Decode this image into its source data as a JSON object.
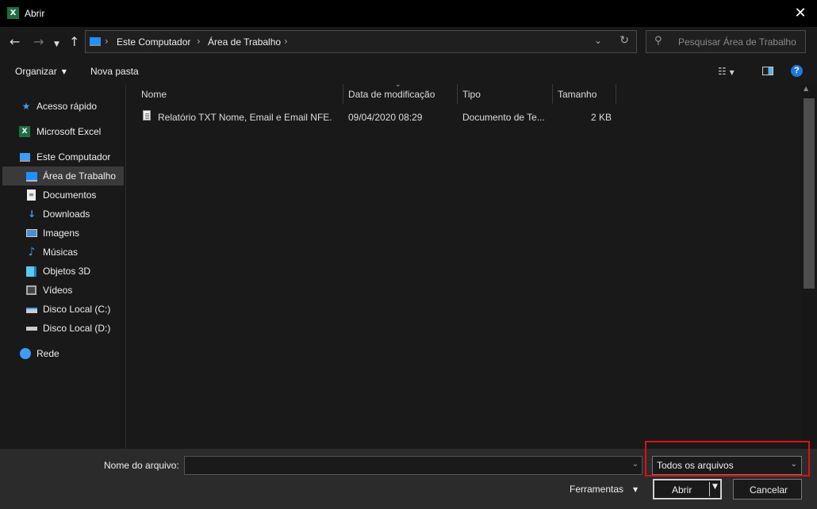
{
  "window": {
    "title": "Abrir",
    "app_icon": "excel-icon"
  },
  "address_bar": {
    "crumbs": [
      "Este Computador",
      "Área de Trabalho"
    ]
  },
  "search": {
    "placeholder": "Pesquisar Área de Trabalho"
  },
  "toolbar": {
    "organize_label": "Organizar",
    "new_folder_label": "Nova pasta"
  },
  "sidebar": {
    "items": [
      {
        "label": "Acesso rápido",
        "icon": "star-icon"
      },
      {
        "label": "Microsoft Excel",
        "icon": "excel-icon"
      },
      {
        "label": "Este Computador",
        "icon": "computer-icon"
      },
      {
        "label": "Área de Trabalho",
        "icon": "desktop-icon",
        "selected": true
      },
      {
        "label": "Documentos",
        "icon": "documents-icon"
      },
      {
        "label": "Downloads",
        "icon": "download-icon"
      },
      {
        "label": "Imagens",
        "icon": "images-icon"
      },
      {
        "label": "Músicas",
        "icon": "music-icon"
      },
      {
        "label": "Objetos 3D",
        "icon": "cube-icon"
      },
      {
        "label": "Vídeos",
        "icon": "video-icon"
      },
      {
        "label": "Disco Local (C:)",
        "icon": "drive-icon"
      },
      {
        "label": "Disco Local (D:)",
        "icon": "drive-icon"
      },
      {
        "label": "Rede",
        "icon": "network-icon"
      }
    ]
  },
  "file_list": {
    "columns": [
      "Nome",
      "Data de modificação",
      "Tipo",
      "Tamanho"
    ],
    "rows": [
      {
        "name": "Relatório TXT Nome, Email  e Email NFE.",
        "modified": "09/04/2020 08:29",
        "type": "Documento de Te...",
        "size": "2 KB"
      }
    ]
  },
  "bottom": {
    "filename_label": "Nome do arquivo:",
    "filename_value": "",
    "filetype_value": "Todos os arquivos",
    "tools_label": "Ferramentas",
    "open_label": "Abrir",
    "cancel_label": "Cancelar"
  },
  "colors": {
    "accent": "#1e7ad6",
    "highlight": "#e01010",
    "excel": "#1d6f42"
  }
}
